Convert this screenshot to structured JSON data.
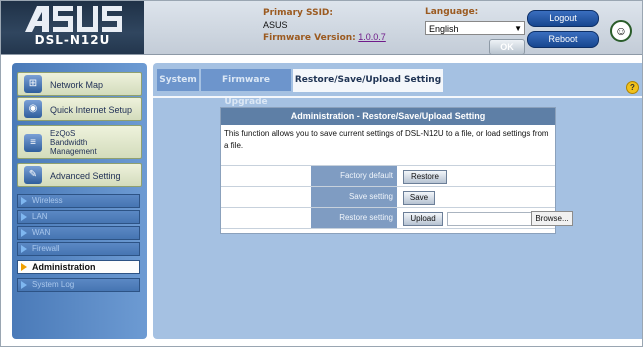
{
  "header": {
    "logo_text": "ASUS",
    "model": "DSL-N12U",
    "ssid_label": "Primary SSID:",
    "ssid_value": "ASUS",
    "fw_label": "Firmware Version:",
    "fw_value": "1.0.0.7",
    "language_label": "Language:",
    "language_value": "English",
    "ok_label": "OK",
    "logout_label": "Logout",
    "reboot_label": "Reboot"
  },
  "sidebar": {
    "items": [
      {
        "label": "Network Map",
        "icon": "network-icon"
      },
      {
        "label": "Quick Internet Setup",
        "icon": "globe-icon"
      },
      {
        "label": "EzQoS Bandwidth Management",
        "icon": "qos-icon"
      },
      {
        "label": "Advanced Setting",
        "icon": "tools-icon"
      }
    ],
    "ezqos_line1": "EzQoS",
    "ezqos_line2": "Bandwidth",
    "ezqos_line3": "Management",
    "sub_items": [
      {
        "label": "Wireless"
      },
      {
        "label": "LAN"
      },
      {
        "label": "WAN"
      },
      {
        "label": "Firewall"
      },
      {
        "label": "Administration"
      },
      {
        "label": "System Log"
      }
    ]
  },
  "tabs": [
    {
      "label": "System"
    },
    {
      "label": "Firmware Upgrade"
    },
    {
      "label": "Restore/Save/Upload Setting"
    }
  ],
  "panel": {
    "title": "Administration - Restore/Save/Upload Setting",
    "description": "This function allows you to save current settings of DSL-N12U to a file, or load settings from a file.",
    "rows": [
      {
        "label": "Factory default",
        "button": "Restore"
      },
      {
        "label": "Save setting",
        "button": "Save"
      },
      {
        "label": "Restore setting",
        "button": "Upload"
      }
    ],
    "browse_label": "Browse..."
  }
}
